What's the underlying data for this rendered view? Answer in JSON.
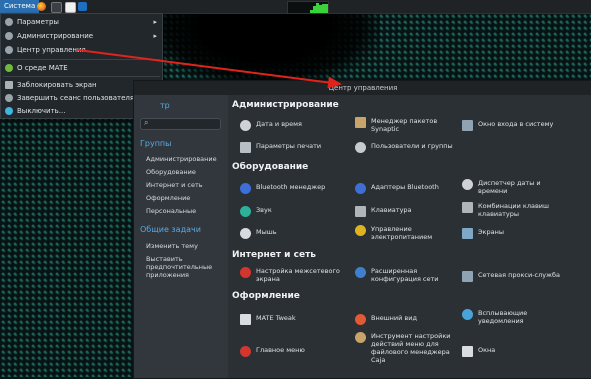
{
  "panel": {
    "system_menu": "Система",
    "accent": "#2c6fb0",
    "cpu_levels": [
      0.3,
      0.6,
      0.9,
      0.7,
      0.85,
      0.8
    ]
  },
  "system_menu": {
    "items": [
      {
        "label": "Параметры",
        "has_submenu": true,
        "icon": "preferences-icon"
      },
      {
        "label": "Администрирование",
        "has_submenu": true,
        "icon": "administration-icon"
      },
      {
        "label": "Центр управления",
        "has_submenu": false,
        "icon": "control-center-icon"
      },
      {
        "label": "О среде MATE",
        "has_submenu": false,
        "icon": "mate-logo-icon"
      },
      {
        "label": "Заблокировать экран",
        "has_submenu": false,
        "icon": "lock-screen-icon"
      },
      {
        "label": "Завершить сеанс пользователя emelya...",
        "has_submenu": false,
        "icon": "logout-icon"
      },
      {
        "label": "Выключить...",
        "has_submenu": false,
        "icon": "power-icon"
      }
    ]
  },
  "control_center": {
    "title": "Центр управления",
    "sidebar": {
      "search_partial": "тр",
      "groups_title": "Группы",
      "groups": [
        "Администрирование",
        "Оборудование",
        "Интернет и сеть",
        "Оформление",
        "Персональные"
      ],
      "tasks_title": "Общие задачи",
      "tasks": [
        "Изменить тему",
        "Выставить предпочтительные приложения"
      ]
    },
    "sections": [
      {
        "title": "Администрирование",
        "items": [
          {
            "label": "Дата и время",
            "icon": "clock-icon",
            "color": "#cfd3d6"
          },
          {
            "label": "Менеджер пакетов Synaptic",
            "icon": "package-manager-icon",
            "color": "#c9a46a"
          },
          {
            "label": "Окно входа в систему",
            "icon": "login-window-icon",
            "color": "#8fa3b3"
          },
          {
            "label": "Параметры печати",
            "icon": "printer-icon",
            "color": "#b8bfc5"
          },
          {
            "label": "Пользователи и группы",
            "icon": "users-icon",
            "color": "#c5cbd1"
          }
        ]
      },
      {
        "title": "Оборудование",
        "items": [
          {
            "label": "Bluetooth менеджер",
            "icon": "bluetooth-icon",
            "color": "#3d6fd6"
          },
          {
            "label": "Адаптеры Bluetooth",
            "icon": "bluetooth-adapter-icon",
            "color": "#3d6fd6"
          },
          {
            "label": "Диспетчер даты и времени",
            "icon": "time-dispatcher-icon",
            "color": "#cfd3d6"
          },
          {
            "label": "Звук",
            "icon": "sound-icon",
            "color": "#2ab29a"
          },
          {
            "label": "Клавиатура",
            "icon": "keyboard-icon",
            "color": "#aeb5bb"
          },
          {
            "label": "Комбинации клавиш клавиатуры",
            "icon": "shortcuts-icon",
            "color": "#aeb5bb"
          },
          {
            "label": "Мышь",
            "icon": "mouse-icon",
            "color": "#d7dbde"
          },
          {
            "label": "Управление электропитанием",
            "icon": "power-management-icon",
            "color": "#e0b21e"
          },
          {
            "label": "Экраны",
            "icon": "displays-icon",
            "color": "#7fa8c7"
          }
        ]
      },
      {
        "title": "Интернет и сеть",
        "items": [
          {
            "label": "Настройка межсетевого экрана",
            "icon": "firewall-icon",
            "color": "#d2362e"
          },
          {
            "label": "Расширенная конфигурация сети",
            "icon": "network-config-icon",
            "color": "#3f7fcf"
          },
          {
            "label": "Сетевая прокси-служба",
            "icon": "proxy-icon",
            "color": "#8fa3b3"
          }
        ]
      },
      {
        "title": "Оформление",
        "items": [
          {
            "label": "MATE Tweak",
            "icon": "tweak-icon",
            "color": "#d9dde0"
          },
          {
            "label": "Внешний вид",
            "icon": "appearance-icon",
            "color": "#e05a36"
          },
          {
            "label": "Всплывающие уведомления",
            "icon": "notifications-icon",
            "color": "#4aa3d8"
          },
          {
            "label": "Главное меню",
            "icon": "main-menu-icon",
            "color": "#d2362e"
          },
          {
            "label": "Инструмент настройки действий меню для файлового менеджера Caja",
            "icon": "caja-actions-icon",
            "color": "#c9a46a"
          },
          {
            "label": "Окна",
            "icon": "windows-icon",
            "color": "#d9dde0"
          }
        ]
      }
    ]
  }
}
